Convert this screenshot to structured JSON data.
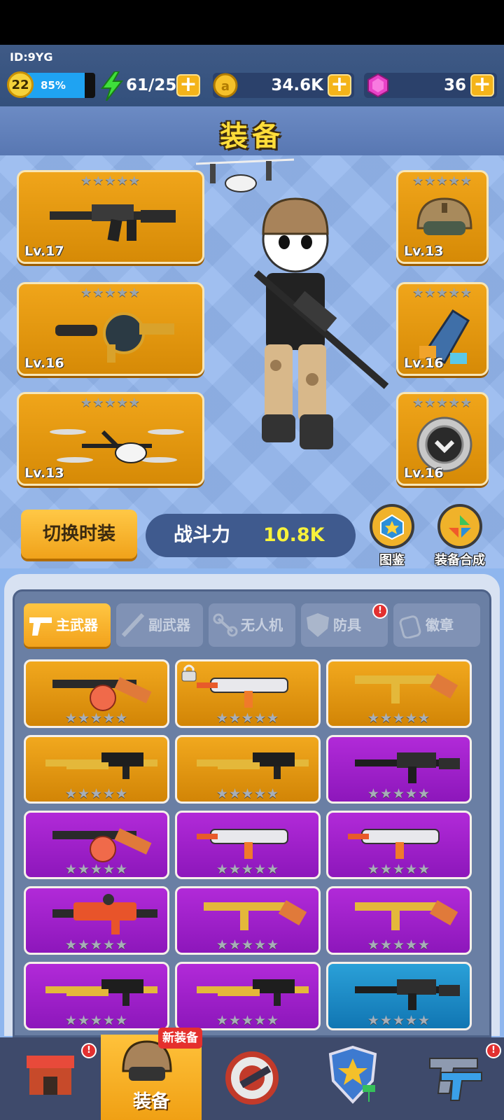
{
  "header": {
    "player_id": "ID:9YG",
    "level": "22",
    "xp_percent_text": "85%",
    "xp_fraction": 0.85,
    "energy": "61/25",
    "coins": "34.6K",
    "gems": "36",
    "plus": "+"
  },
  "page_title": "装备",
  "equipped": {
    "stars": "★★★★★",
    "left": [
      {
        "name": "rifle",
        "level": "Lv.17"
      },
      {
        "name": "grenade-launcher",
        "level": "Lv.16"
      },
      {
        "name": "drone",
        "level": "Lv.13"
      }
    ],
    "right": [
      {
        "name": "helmet",
        "level": "Lv.13"
      },
      {
        "name": "armor",
        "level": "Lv.16"
      },
      {
        "name": "badge",
        "level": "Lv.16"
      }
    ]
  },
  "actions": {
    "switch_outfit": "切换时装",
    "power_label": "战斗力",
    "power_value": "10.8K",
    "codex": "图鉴",
    "synthesis": "装备合成"
  },
  "tabs": [
    {
      "label": "主武器",
      "active": true
    },
    {
      "label": "副武器",
      "active": false
    },
    {
      "label": "无人机",
      "active": false
    },
    {
      "label": "防具",
      "active": false,
      "alert": "!"
    },
    {
      "label": "徽章",
      "active": false
    }
  ],
  "inventory": {
    "stars": "★★★★★",
    "items": [
      {
        "rarity": "gold",
        "weapon": "drum-smg"
      },
      {
        "rarity": "gold",
        "weapon": "white-rifle",
        "locked": true
      },
      {
        "rarity": "gold",
        "weapon": "tommy-gun"
      },
      {
        "rarity": "gold",
        "weapon": "machine-gun"
      },
      {
        "rarity": "gold",
        "weapon": "machine-gun"
      },
      {
        "rarity": "purple",
        "weapon": "assault-rifle"
      },
      {
        "rarity": "purple",
        "weapon": "drum-smg"
      },
      {
        "rarity": "purple",
        "weapon": "white-rifle"
      },
      {
        "rarity": "purple",
        "weapon": "white-rifle"
      },
      {
        "rarity": "purple",
        "weapon": "red-rifle"
      },
      {
        "rarity": "purple",
        "weapon": "tommy-gun"
      },
      {
        "rarity": "purple",
        "weapon": "tommy-gun"
      },
      {
        "rarity": "purple",
        "weapon": "machine-gun"
      },
      {
        "rarity": "purple",
        "weapon": "machine-gun"
      },
      {
        "rarity": "blue",
        "weapon": "assault-rifle"
      }
    ]
  },
  "bottom_nav": {
    "equip_label": "装备",
    "new_badge": "新装备",
    "alert": "!"
  },
  "colors": {
    "gold_card": "#e89a12",
    "purple_card": "#a021cf",
    "blue_card": "#1d8ccb",
    "accent_yellow": "#ffdd3a",
    "power_value": "#f7f23b"
  }
}
